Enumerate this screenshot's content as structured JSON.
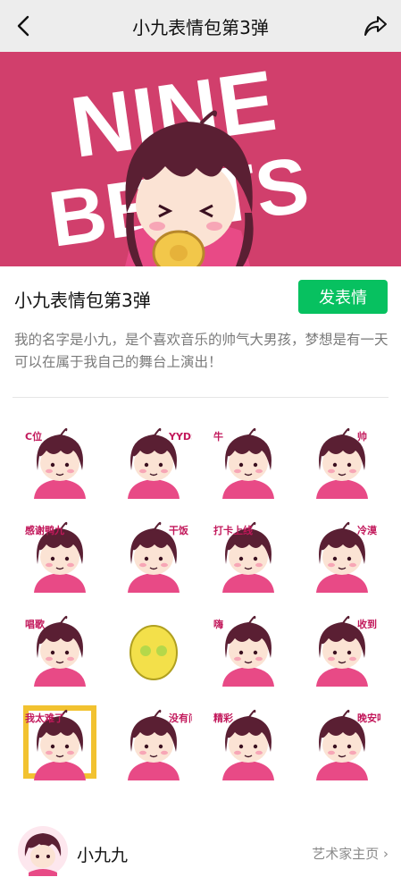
{
  "navbar": {
    "title": "小九表情包第3弹"
  },
  "banner": {
    "brand_text_line1": "NINE",
    "brand_text_line2": "BEATS",
    "background_color": "#d13f6c"
  },
  "pack": {
    "title": "小九表情包第3弹",
    "send_label": "发表情",
    "description": "我的名字是小九，是个喜欢音乐的帅气大男孩，梦想是有一天可以在属于我自己的舞台上演出！"
  },
  "stickers": [
    {
      "icon": "sticker-guitar",
      "caption": "C位"
    },
    {
      "icon": "sticker-yyds",
      "caption": "YYDS"
    },
    {
      "icon": "sticker-niu",
      "caption": "牛"
    },
    {
      "icon": "sticker-cool",
      "caption": "帅"
    },
    {
      "icon": "sticker-thanks",
      "caption": "感谢鸭九"
    },
    {
      "icon": "sticker-work",
      "caption": "干饭"
    },
    {
      "icon": "sticker-online",
      "caption": "打卡上线"
    },
    {
      "icon": "sticker-keytar",
      "caption": "冷漠"
    },
    {
      "icon": "sticker-sing",
      "caption": "唱歌"
    },
    {
      "icon": "sticker-lemon",
      "caption": ""
    },
    {
      "icon": "sticker-cymbal",
      "caption": "嗨"
    },
    {
      "icon": "sticker-eat",
      "caption": "收到"
    },
    {
      "icon": "sticker-cry",
      "caption": "我太难了"
    },
    {
      "icon": "sticker-ok",
      "caption": "没有问题"
    },
    {
      "icon": "sticker-drum",
      "caption": "精彩"
    },
    {
      "icon": "sticker-sleep",
      "caption": "晚安吧"
    }
  ],
  "artist": {
    "name": "小九九",
    "link_label": "艺术家主页"
  },
  "colors": {
    "accent_green": "#07c160",
    "character_pink": "#e84a86",
    "hair": "#5a1f33"
  }
}
